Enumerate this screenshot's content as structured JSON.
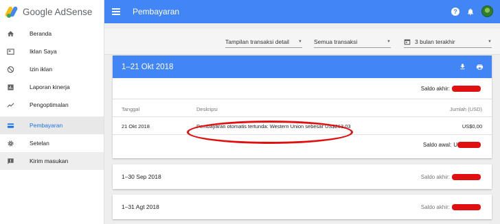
{
  "app": {
    "brand": "Google AdSense"
  },
  "sidebar": {
    "items": [
      {
        "label": "Beranda",
        "icon": "home-icon"
      },
      {
        "label": "Iklan Saya",
        "icon": "ad-units-icon"
      },
      {
        "label": "Izin iklan",
        "icon": "block-icon"
      },
      {
        "label": "Laporan kinerja",
        "icon": "bar-chart-icon"
      },
      {
        "label": "Pengoptimalan",
        "icon": "trending-up-icon"
      },
      {
        "label": "Pembayaran",
        "icon": "payment-icon",
        "active": true
      },
      {
        "label": "Setelan",
        "icon": "gear-icon"
      },
      {
        "label": "Kirim masukan",
        "icon": "feedback-icon"
      }
    ]
  },
  "header": {
    "title": "Pembayaran"
  },
  "filters": {
    "view": "Tampilan transaksi detail",
    "type": "Semua transaksi",
    "range": "3 bulan terakhir"
  },
  "main_period": {
    "title": "1–21 Okt 2018",
    "end_balance_label": "Saldo akhir:",
    "columns": {
      "date": "Tanggal",
      "description": "Deskripsi",
      "amount": "Jumlah (USD)"
    },
    "rows": [
      {
        "date": "21 Okt 2018",
        "description": "Pembayaran otomatis tertunda: Western Union sebesar US$263,03",
        "amount": "US$0,00"
      }
    ],
    "start_balance_label": "Saldo awal:",
    "start_balance_value": "U"
  },
  "periods": [
    {
      "title": "1–30 Sep 2018",
      "end_balance_label": "Saldo akhir:"
    },
    {
      "title": "1–31 Agt 2018",
      "end_balance_label": "Saldo akhir:"
    }
  ],
  "colors": {
    "primary": "#4285f4",
    "highlight": "#e01010"
  }
}
